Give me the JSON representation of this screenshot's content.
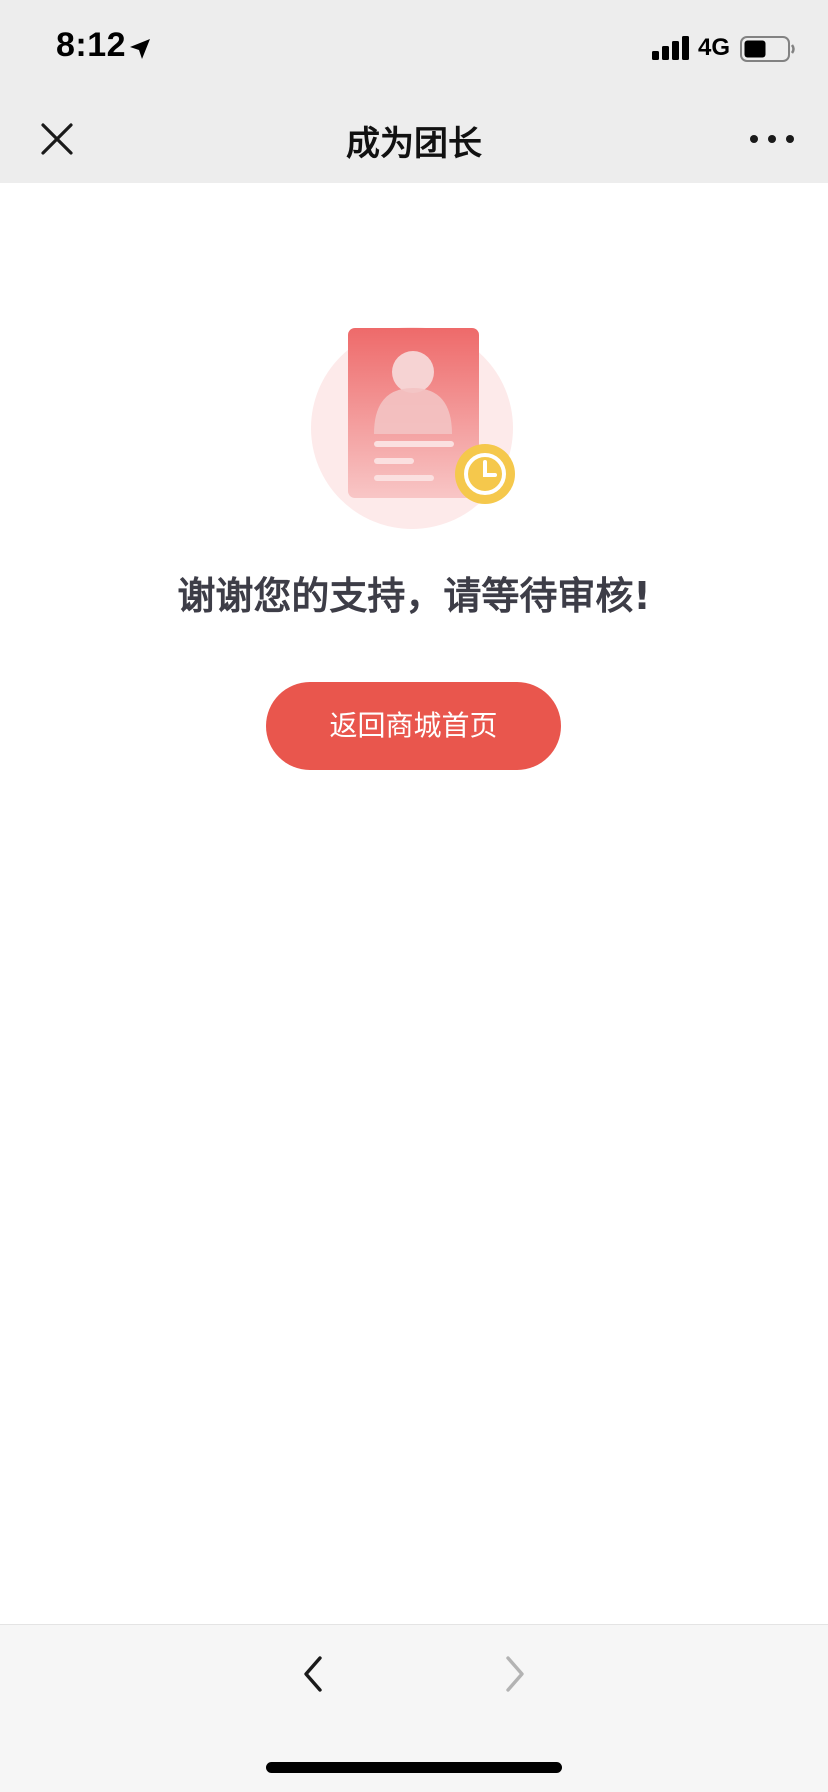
{
  "status_bar": {
    "time": "8:12",
    "network": "4G",
    "icons": [
      "location-arrow-icon",
      "signal-bars-icon",
      "battery-icon"
    ]
  },
  "nav_bar": {
    "title": "成为团长",
    "left_icon": "close-icon",
    "right_icon": "more-icon"
  },
  "content": {
    "illustration": "profile-card-with-clock",
    "message": "谢谢您的支持，请等待审核!",
    "home_button_label": "返回商城首页"
  },
  "bottom_bar": {
    "icons": [
      "back-chevron-icon",
      "forward-chevron-icon"
    ]
  },
  "colors": {
    "accent": "#e9564d",
    "clock_badge": "#f5c84c",
    "nav_bg": "#ededed",
    "text_dark": "#3d3d47"
  }
}
